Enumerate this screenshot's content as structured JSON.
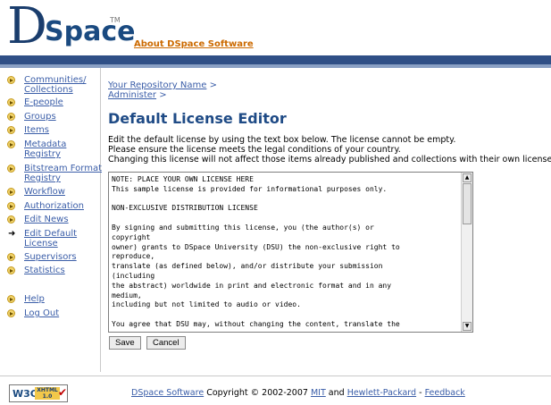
{
  "header": {
    "logo_letter": "D",
    "logo_word": "Space",
    "logo_tm": "TM",
    "about_link": "About DSpace Software"
  },
  "sidebar": {
    "items": [
      {
        "label": "Communities/\nCollections",
        "marker": "bullet"
      },
      {
        "label": "E-people",
        "marker": "bullet"
      },
      {
        "label": "Groups",
        "marker": "bullet"
      },
      {
        "label": "Items",
        "marker": "bullet"
      },
      {
        "label": "Metadata\nRegistry",
        "marker": "bullet"
      },
      {
        "label": "Bitstream Format\nRegistry",
        "marker": "bullet"
      },
      {
        "label": "Workflow",
        "marker": "bullet"
      },
      {
        "label": "Authorization",
        "marker": "bullet"
      },
      {
        "label": "Edit News",
        "marker": "bullet"
      },
      {
        "label": "Edit Default\nLicense",
        "marker": "arrow"
      },
      {
        "label": "Supervisors",
        "marker": "bullet"
      },
      {
        "label": "Statistics",
        "marker": "bullet"
      },
      {
        "label": "Help",
        "marker": "bullet"
      },
      {
        "label": "Log Out",
        "marker": "bullet"
      }
    ]
  },
  "breadcrumb": {
    "repo": "Your Repository Name",
    "sep1": " >",
    "admin": "Administer",
    "sep2": " >"
  },
  "page_title": "Default License Editor",
  "description": [
    "Edit the default license by using the text box below. The license cannot be empty.",
    "Please ensure the license meets the legal conditions of your country.",
    "Changing this license will not affect those items already published and collections with their own licenses."
  ],
  "license_text": "NOTE: PLACE YOUR OWN LICENSE HERE\nThis sample license is provided for informational purposes only.\n\nNON-EXCLUSIVE DISTRIBUTION LICENSE\n\nBy signing and submitting this license, you (the author(s) or\ncopyright\nowner) grants to DSpace University (DSU) the non-exclusive right to\nreproduce,\ntranslate (as defined below), and/or distribute your submission\n(including\nthe abstract) worldwide in print and electronic format and in any\nmedium,\nincluding but not limited to audio or video.\n\nYou agree that DSU may, without changing the content, translate the",
  "buttons": {
    "save": "Save",
    "cancel": "Cancel"
  },
  "footer": {
    "w3c": "W3C",
    "xhtml": "XHTML\n1.0",
    "software_link": "DSpace Software",
    "copyright": " Copyright © 2002-2007 ",
    "mit": "MIT",
    "and": " and ",
    "hp": "Hewlett-Packard",
    "dash": " - ",
    "feedback": "Feedback"
  }
}
